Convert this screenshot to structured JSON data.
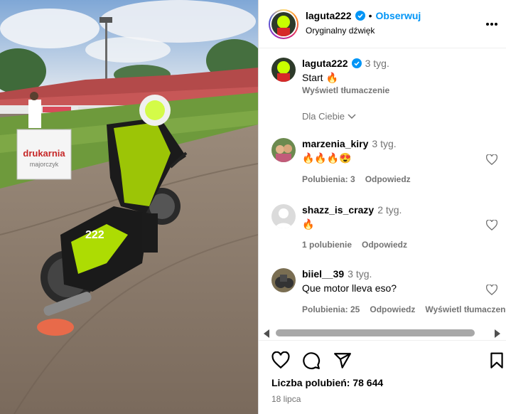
{
  "media": {
    "banner_text_1": "drukarnia",
    "banner_text_2": "majorczyk",
    "bike_number": "222"
  },
  "header": {
    "username": "laguta222",
    "separator": "•",
    "follow_label": "Obserwuj",
    "audio_label": "Oryginalny dźwięk"
  },
  "caption": {
    "username": "laguta222",
    "time": "3 tyg.",
    "text": "Start 🔥",
    "translate_label": "Wyświetl tłumaczenie"
  },
  "sort_label": "Dla Ciebie",
  "comments": [
    {
      "username": "marzenia_kiry",
      "time": "3 tyg.",
      "text": "🔥🔥🔥😍",
      "likes": "Polubienia: 3",
      "reply": "Odpowiedz",
      "translate": ""
    },
    {
      "username": "shazz_is_crazy",
      "time": "2 tyg.",
      "text": "🔥",
      "likes": "1 polubienie",
      "reply": "Odpowiedz",
      "translate": ""
    },
    {
      "username": "biiel__39",
      "time": "3 tyg.",
      "text": "Que motor lleva eso?",
      "likes": "Polubienia: 25",
      "reply": "Odpowiedz",
      "translate": "Wyświetl tłumaczenie"
    }
  ],
  "footer": {
    "likes_text": "Liczba polubień: 78 644",
    "date_text": "18 lipca"
  },
  "colors": {
    "accent": "#0095f6",
    "verified": "#0095f6",
    "secondary_text": "#737373",
    "neon": "#c8ff00"
  }
}
